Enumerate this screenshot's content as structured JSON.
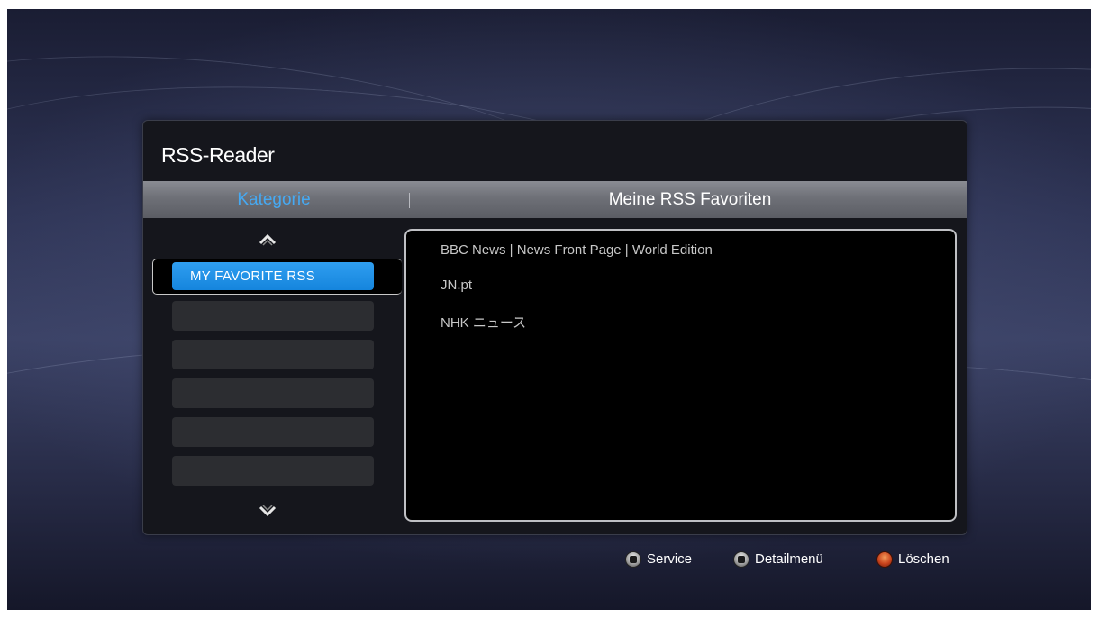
{
  "app": {
    "title": "RSS-Reader"
  },
  "header": {
    "category_tab": "Kategorie",
    "favorites_tab": "Meine RSS Favoriten"
  },
  "categories": {
    "selected_label": "MY FAVORITE RSS",
    "empty_slots": 5
  },
  "feeds": [
    {
      "label": "BBC News | News Front Page | World Edition"
    },
    {
      "label": "JN.pt"
    },
    {
      "label": "NHK ニュース"
    }
  ],
  "footer": {
    "service": {
      "label": "Service",
      "icon": "stop-button-icon"
    },
    "detail": {
      "label": "Detailmenü",
      "icon": "menu-button-icon"
    },
    "delete": {
      "label": "Löschen",
      "icon": "red-button-icon"
    }
  },
  "colors": {
    "accent": "#46a9f2",
    "selected": "#1d8fe6",
    "delete_button": "#c8431c"
  }
}
